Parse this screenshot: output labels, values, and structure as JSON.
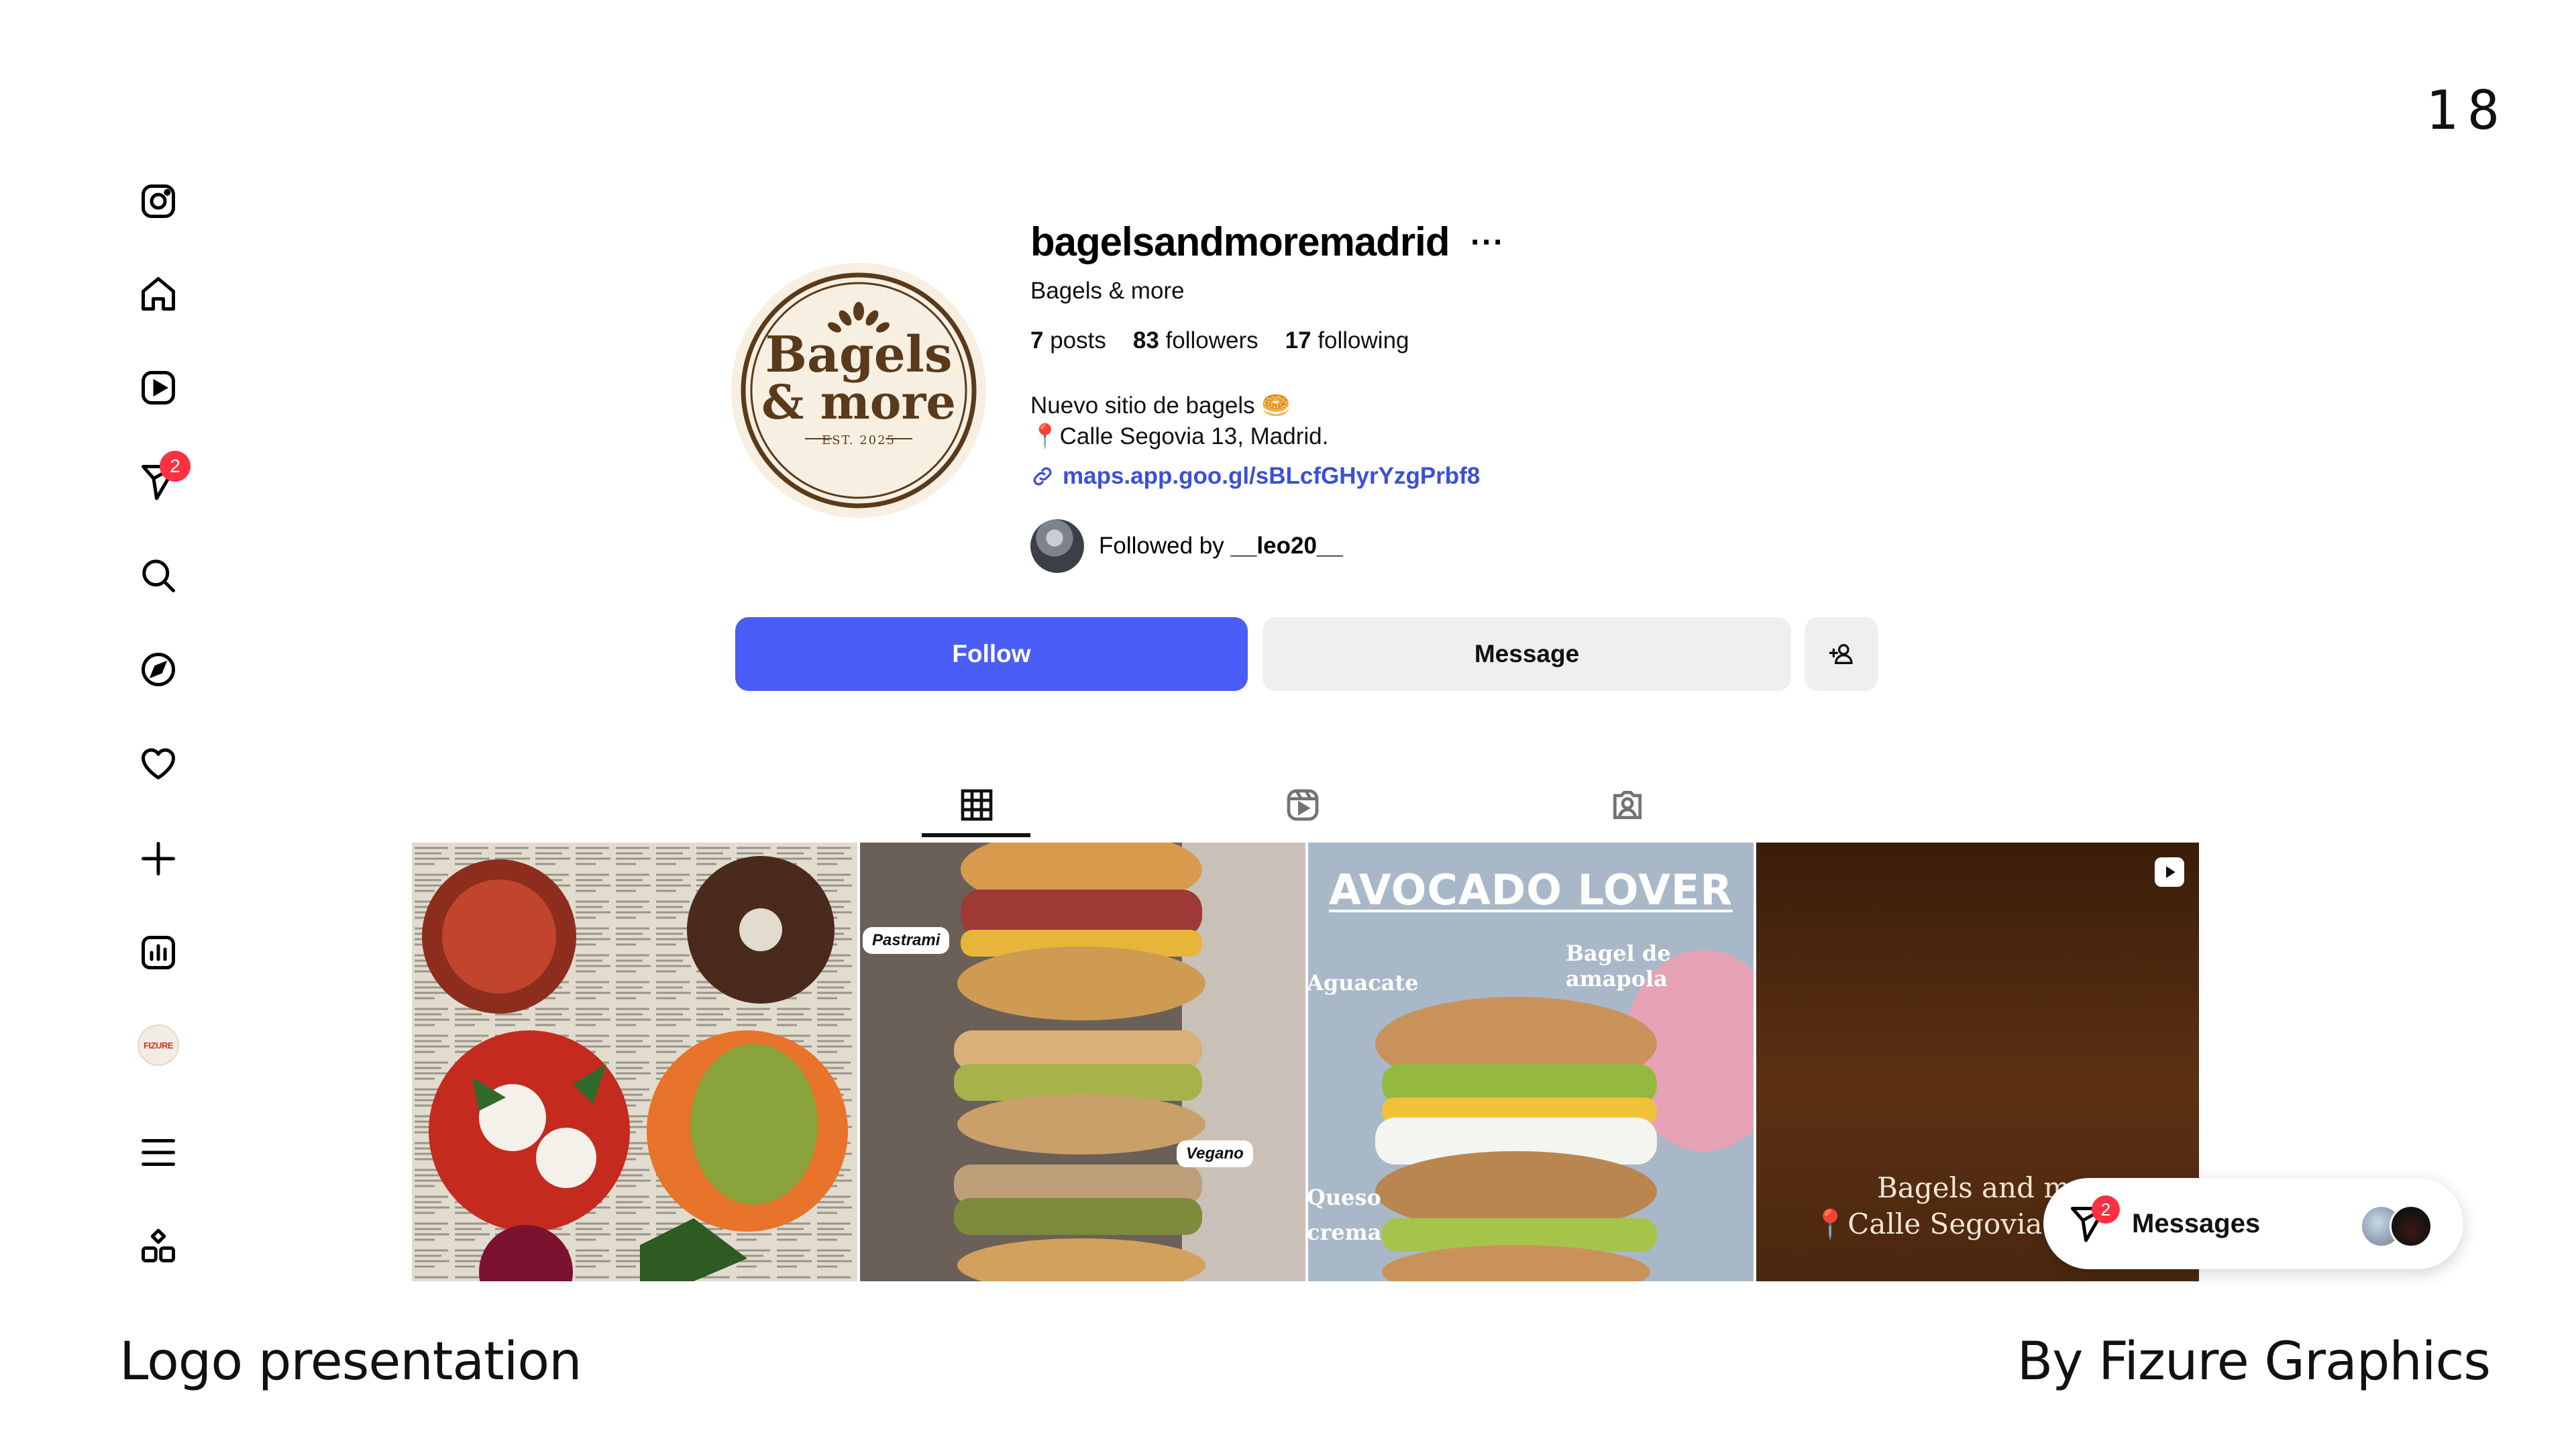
{
  "page_number": "18",
  "footer": {
    "left": "Logo presentation",
    "right": "By Fizure Graphics"
  },
  "sidebar": {
    "items": [
      {
        "name": "instagram",
        "icon": "instagram-icon"
      },
      {
        "name": "home",
        "icon": "home-icon"
      },
      {
        "name": "reels",
        "icon": "reels-icon"
      },
      {
        "name": "messages",
        "icon": "messenger-icon",
        "badge": "2"
      },
      {
        "name": "search",
        "icon": "search-icon"
      },
      {
        "name": "explore",
        "icon": "compass-icon"
      },
      {
        "name": "notifications",
        "icon": "heart-icon"
      },
      {
        "name": "create",
        "icon": "plus-icon"
      },
      {
        "name": "dashboard",
        "icon": "chart-icon"
      },
      {
        "name": "profile",
        "icon": "profile-avatar-icon",
        "label": "FIZURE"
      },
      {
        "name": "more",
        "icon": "menu-icon"
      },
      {
        "name": "also-from-meta",
        "icon": "apps-icon"
      }
    ]
  },
  "profile": {
    "username": "bagelsandmoremadrid",
    "more": "···",
    "full_name": "Bagels & more",
    "stats": {
      "posts_count": "7",
      "posts_label": "posts",
      "followers_count": "83",
      "followers_label": "followers",
      "following_count": "17",
      "following_label": "following"
    },
    "bio_line1": "Nuevo sitio de bagels 🥯",
    "bio_line2": "📍Calle Segovia 13, Madrid.",
    "link": "maps.app.goo.gl/sBLcfGHyrYzgPrbf8",
    "followed_by_prefix": "Followed by",
    "followed_by_user": "__leo20__",
    "logo": {
      "line1": "Bagels",
      "line2": "& more",
      "est": "EST. 2025"
    }
  },
  "buttons": {
    "follow": "Follow",
    "message": "Message"
  },
  "tabs": [
    {
      "icon": "grid-icon",
      "active": true
    },
    {
      "icon": "reels-icon"
    },
    {
      "icon": "tagged-icon"
    }
  ],
  "posts": {
    "post2": {
      "tag1": "Pastrami",
      "tag2": "Vegano"
    },
    "post3": {
      "title": "AVOCADO LOVER",
      "label1": "Bagel de amapola",
      "label2": "Aguacate",
      "label3": "Queso",
      "label4": "crema"
    },
    "post4": {
      "line1": "Bagels and more",
      "line2": "📍Calle Segovia 13,"
    }
  },
  "messages_pill": {
    "label": "Messages",
    "badge": "2"
  },
  "colors": {
    "accent": "#4a5df7",
    "badge": "#ff3040",
    "link": "#3b4fd8",
    "logo_brown": "#5a3a1a"
  }
}
